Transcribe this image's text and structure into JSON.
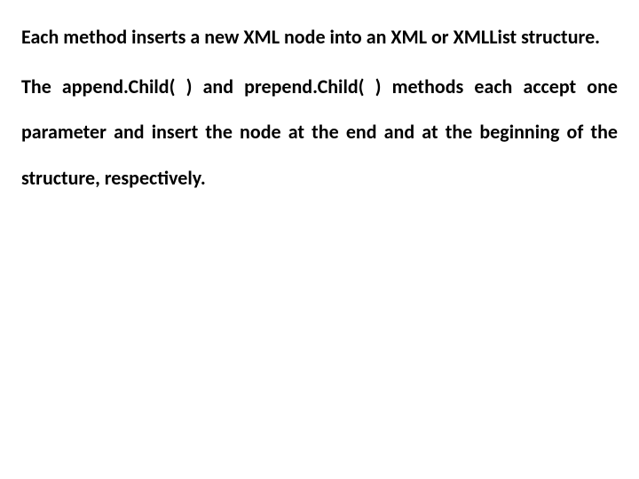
{
  "paragraphs": {
    "p1": "Each method inserts a new XML node into an XML or XMLList structure.",
    "p2": "The append.Child( ) and prepend.Child( ) methods each accept one parameter and insert the node at the end and at the beginning of the structure, respectively."
  }
}
